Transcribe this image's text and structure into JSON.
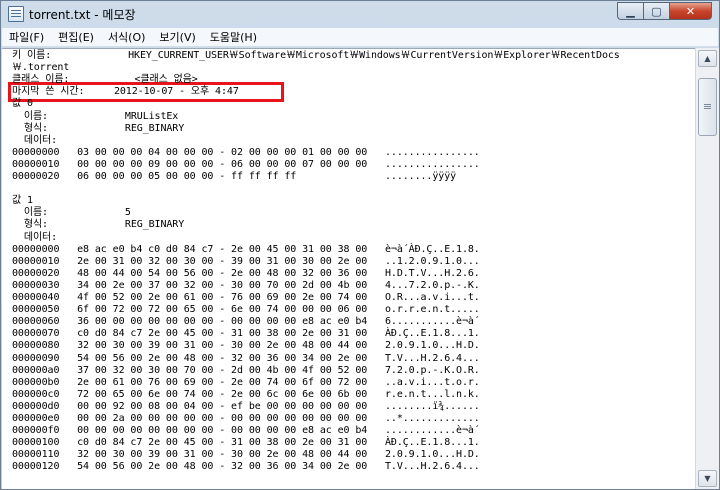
{
  "window": {
    "title": "torrent.txt - 메모장"
  },
  "menu": [
    "파일(F)",
    "편집(E)",
    "서식(O)",
    "보기(V)",
    "도움말(H)"
  ],
  "lines": [
    "키 이름:             HKEY_CURRENT_USER￦Software￦Microsoft￦Windows￦CurrentVersion￦Explorer￦RecentDocs",
    "￦.torrent",
    "클래스 이름:           <클래스 없음>",
    "마지막 쓴 시간:     2012-10-07 - 오후 4:47",
    "값 0",
    "  이름:             MRUListEx",
    "  형식:             REG_BINARY",
    "  데이터:",
    "00000000   03 00 00 00 04 00 00 00 - 02 00 00 00 01 00 00 00   ................",
    "00000010   00 00 00 00 09 00 00 00 - 06 00 00 00 07 00 00 00   ................",
    "00000020   06 00 00 00 05 00 00 00 - ff ff ff ff               ........ÿÿÿÿ",
    "",
    "값 1",
    "  이름:             5",
    "  형식:             REG_BINARY",
    "  데이터:",
    "00000000   e8 ac e0 b4 c0 d0 84 c7 - 2e 00 45 00 31 00 38 00   è¬à´ÀÐ.Ç..E.1.8.",
    "00000010   2e 00 31 00 32 00 30 00 - 39 00 31 00 30 00 2e 00   ..1.2.0.9.1.0...",
    "00000020   48 00 44 00 54 00 56 00 - 2e 00 48 00 32 00 36 00   H.D.T.V...H.2.6.",
    "00000030   34 00 2e 00 37 00 32 00 - 30 00 70 00 2d 00 4b 00   4...7.2.0.p.-.K.",
    "00000040   4f 00 52 00 2e 00 61 00 - 76 00 69 00 2e 00 74 00   O.R...a.v.i...t.",
    "00000050   6f 00 72 00 72 00 65 00 - 6e 00 74 00 00 00 06 00   o.r.r.e.n.t.....",
    "00000060   36 00 00 00 00 00 00 00 - 00 00 00 00 e8 ac e0 b4   6...........è¬à´",
    "00000070   c0 d0 84 c7 2e 00 45 00 - 31 00 38 00 2e 00 31 00   ÀÐ.Ç..E.1.8...1.",
    "00000080   32 00 30 00 39 00 31 00 - 30 00 2e 00 48 00 44 00   2.0.9.1.0...H.D.",
    "00000090   54 00 56 00 2e 00 48 00 - 32 00 36 00 34 00 2e 00   T.V...H.2.6.4...",
    "000000a0   37 00 32 00 30 00 70 00 - 2d 00 4b 00 4f 00 52 00   7.2.0.p.-.K.O.R.",
    "000000b0   2e 00 61 00 76 00 69 00 - 2e 00 74 00 6f 00 72 00   ..a.v.i...t.o.r.",
    "000000c0   72 00 65 00 6e 00 74 00 - 2e 00 6c 00 6e 00 6b 00   r.e.n.t...l.n.k.",
    "000000d0   00 00 92 00 08 00 04 00 - ef be 00 00 00 00 00 00   ........ï¾......",
    "000000e0   00 00 2a 00 00 00 00 00 - 00 00 00 00 00 00 00 00   ..*.............",
    "000000f0   00 00 00 00 00 00 00 00 - 00 00 00 00 e8 ac e0 b4   ............è¬à´",
    "00000100   c0 d0 84 c7 2e 00 45 00 - 31 00 38 00 2e 00 31 00   ÀÐ.Ç..E.1.8...1.",
    "00000110   32 00 30 00 39 00 31 00 - 30 00 2e 00 48 00 44 00   2.0.9.1.0...H.D.",
    "00000120   54 00 56 00 2e 00 48 00 - 32 00 36 00 34 00 2e 00   T.V...H.2.6.4..."
  ],
  "highlight_color": "#e8141b"
}
